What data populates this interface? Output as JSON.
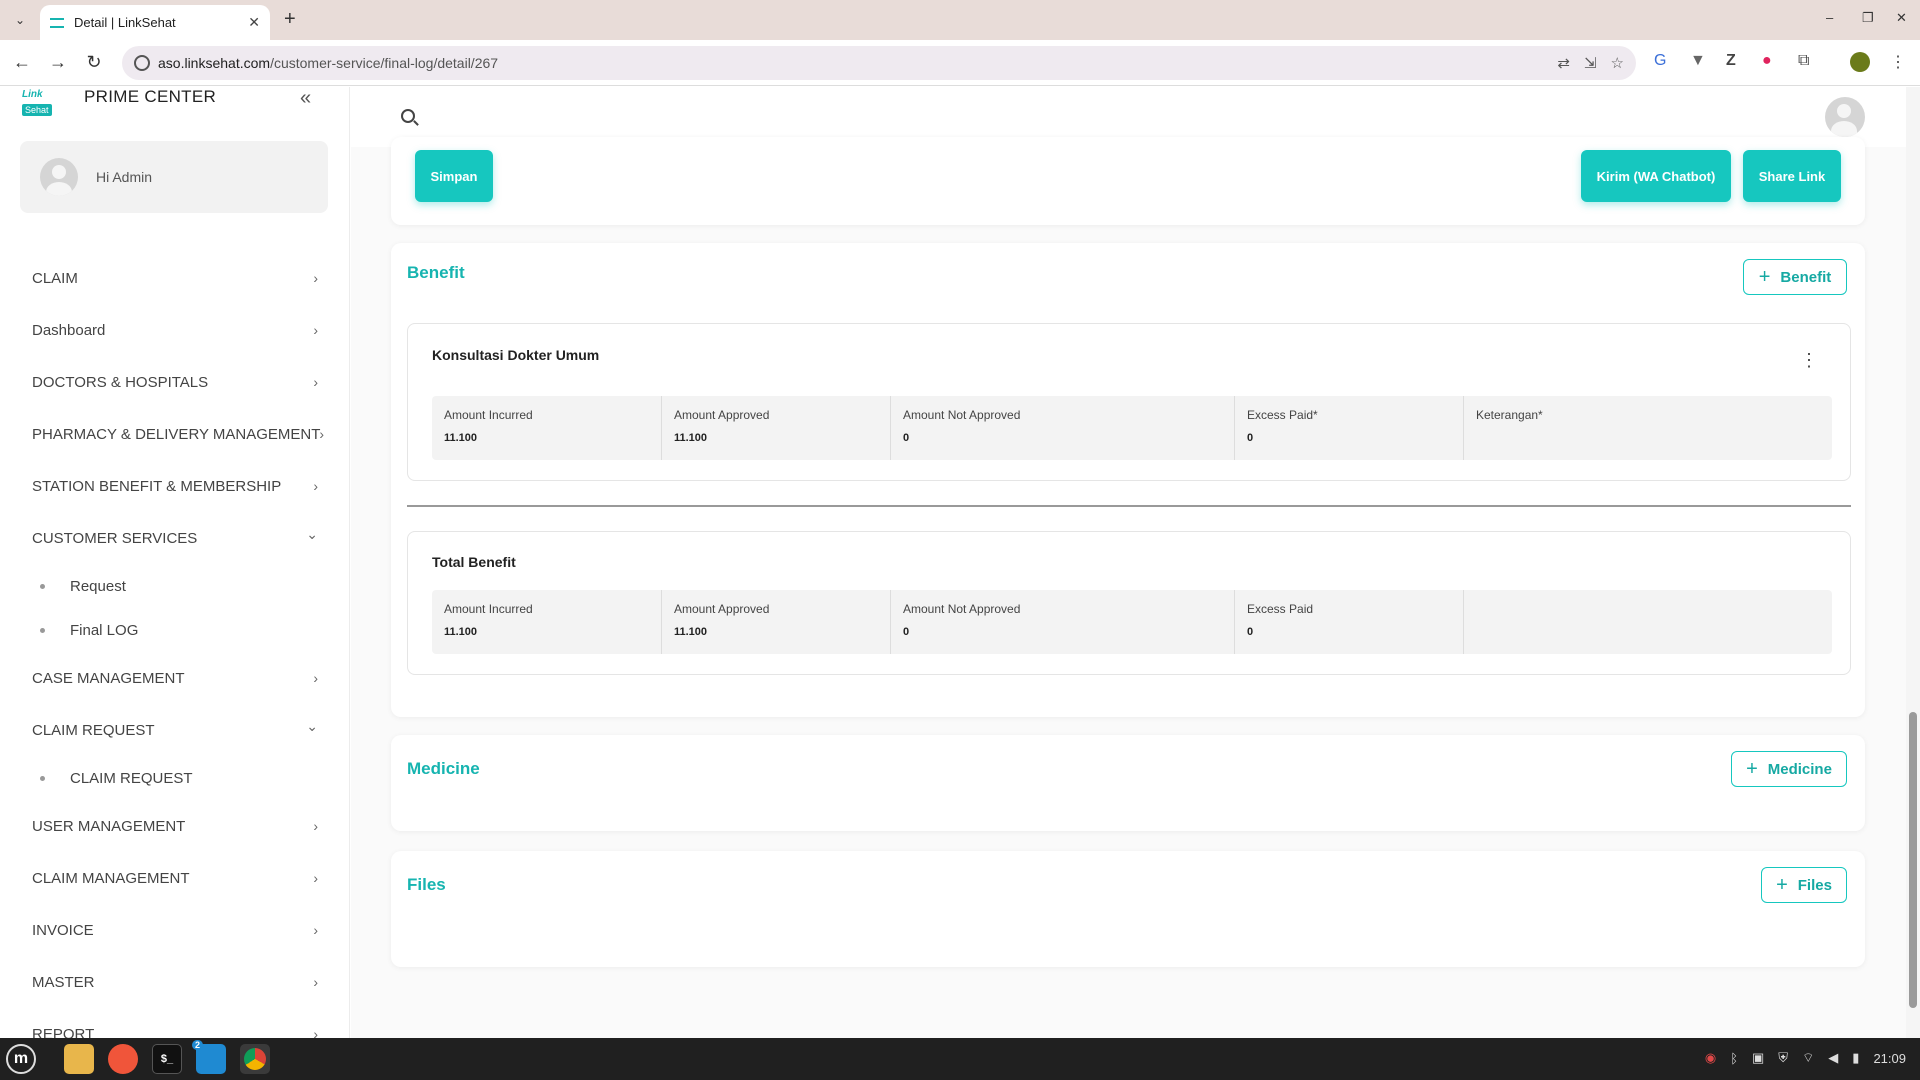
{
  "browser": {
    "tab_title": "Detail | LinkSehat",
    "url_host": "aso.linksehat.com",
    "url_path": "/customer-service/final-log/detail/267",
    "new_tab": "+",
    "tab_close": "✕",
    "tab_list": "⌄",
    "win_minimize": "–",
    "win_restore": "❐",
    "win_close": "✕",
    "nav": {
      "back": "←",
      "forward": "→",
      "reload": "↻",
      "menu": "⋮"
    },
    "omni_icons": [
      "translate-icon",
      "install-icon",
      "star-icon"
    ],
    "extensions": [
      "translate-ext-icon",
      "vuetify-ext-icon",
      "zotero-ext-icon",
      "record-ext-icon",
      "puzzle-icon",
      "profile-icon"
    ]
  },
  "sidebar": {
    "logo_top": "Link",
    "logo_bottom": "Sehat",
    "brand": "PRIME CENTER",
    "collapse_icon": "«",
    "greeting": "Hi Admin",
    "chevron_right": "›",
    "chevron_down": "⌄",
    "menu": [
      {
        "label": "CLAIM",
        "expanded": false
      },
      {
        "label": "Dashboard",
        "expanded": false
      },
      {
        "label": "DOCTORS & HOSPITALS",
        "expanded": false
      },
      {
        "label": "PHARMACY & DELIVERY MANAGEMENT",
        "expanded": false
      },
      {
        "label": "STATION BENEFIT & MEMBERSHIP",
        "expanded": false
      },
      {
        "label": "CUSTOMER SERVICES",
        "expanded": true
      },
      {
        "label": "Request",
        "sub": true
      },
      {
        "label": "Final LOG",
        "sub": true
      },
      {
        "label": "CASE MANAGEMENT",
        "expanded": false
      },
      {
        "label": "CLAIM REQUEST",
        "expanded": true
      },
      {
        "label": "CLAIM REQUEST",
        "sub": true
      },
      {
        "label": "USER MANAGEMENT",
        "expanded": false
      },
      {
        "label": "CLAIM MANAGEMENT",
        "expanded": false
      },
      {
        "label": "INVOICE",
        "expanded": false
      },
      {
        "label": "MASTER",
        "expanded": false
      },
      {
        "label": "REPORT",
        "expanded": false
      }
    ]
  },
  "actions": {
    "save": "Simpan",
    "send_wa": "Kirim (WA Chatbot)",
    "share": "Share Link"
  },
  "benefit": {
    "title": "Benefit",
    "add_label": "Benefit",
    "plus": "+",
    "kebab": "⋮",
    "item": {
      "name": "Konsultasi Dokter Umum",
      "cols": [
        {
          "label": "Amount Incurred",
          "value": "11.100"
        },
        {
          "label": "Amount Approved",
          "value": "11.100"
        },
        {
          "label": "Amount Not Approved",
          "value": "0"
        },
        {
          "label": "Excess Paid*",
          "value": "0"
        },
        {
          "label": "Keterangan*",
          "value": ""
        }
      ]
    },
    "total": {
      "name": "Total Benefit",
      "cols": [
        {
          "label": "Amount Incurred",
          "value": "11.100"
        },
        {
          "label": "Amount Approved",
          "value": "11.100"
        },
        {
          "label": "Amount Not Approved",
          "value": "0"
        },
        {
          "label": "Excess Paid",
          "value": "0"
        },
        {
          "label": "",
          "value": ""
        }
      ]
    }
  },
  "medicine": {
    "title": "Medicine",
    "add_label": "Medicine"
  },
  "files": {
    "title": "Files",
    "add_label": "Files"
  },
  "taskbar": {
    "time": "21:09",
    "badge": "2"
  },
  "colors": {
    "accent": "#16c7bf",
    "accent_text": "#16b4b0"
  }
}
